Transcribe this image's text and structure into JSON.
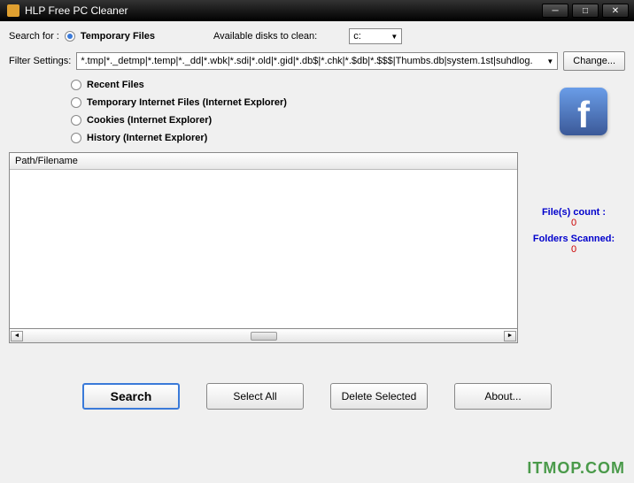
{
  "title": "HLP Free PC Cleaner",
  "search_for_label": "Search for :",
  "search_for_option": "Temporary Files",
  "available_disks_label": "Available disks to clean:",
  "disk_selected": "c:",
  "filter_label": "Filter Settings:",
  "filter_value": "*.tmp|*._detmp|*.temp|*._dd|*.wbk|*.sdi|*.old|*.gid|*.db$|*.chk|*.$db|*.$$$|Thumbs.db|system.1st|suhdlog.",
  "change_button": "Change...",
  "options": [
    "Recent Files",
    "Temporary Internet Files (Internet Explorer)",
    "Cookies  (Internet Explorer)",
    "History  (Internet Explorer)"
  ],
  "table_header": "Path/Filename",
  "stats": {
    "files_label": "File(s) count :",
    "files_value": "0",
    "folders_label": "Folders Scanned:",
    "folders_value": "0"
  },
  "buttons": {
    "search": "Search",
    "select_all": "Select All",
    "delete": "Delete Selected",
    "about": "About..."
  },
  "watermark": "ITMOP.COM"
}
